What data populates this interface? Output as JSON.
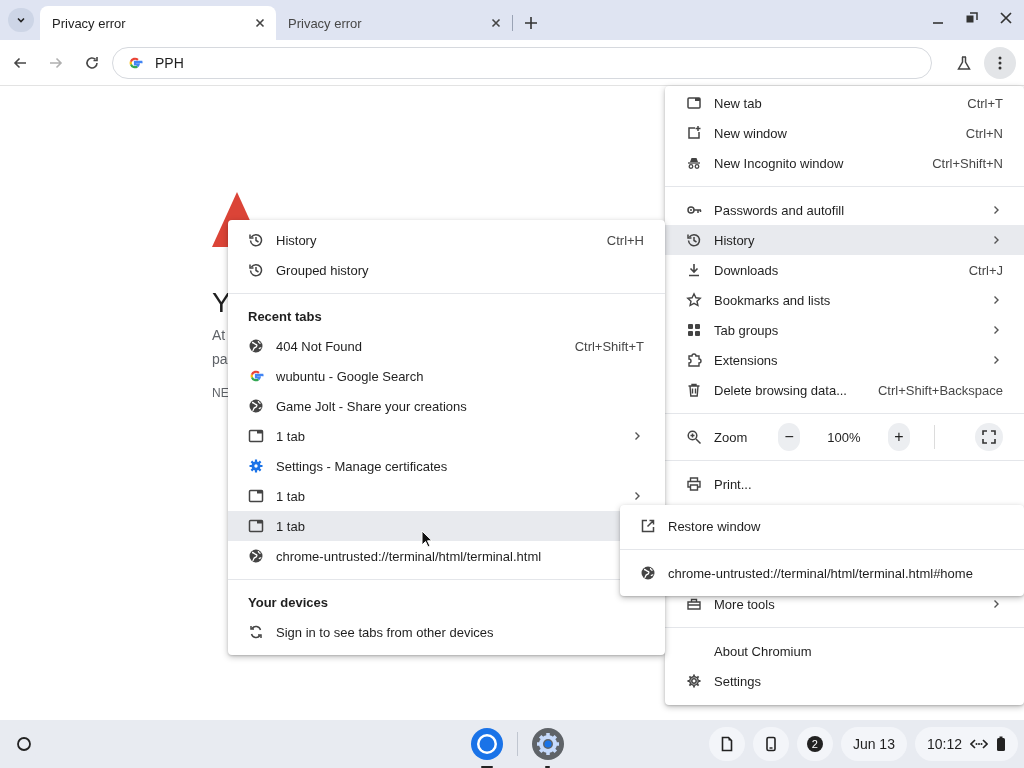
{
  "tabs": [
    {
      "title": "Privacy error",
      "selected": true
    },
    {
      "title": "Privacy error",
      "selected": false
    }
  ],
  "nav": [
    {
      "kind": "back",
      "disabled": false
    },
    {
      "kind": "forward",
      "disabled": true
    },
    {
      "kind": "reload",
      "disabled": false
    }
  ],
  "address": {
    "value": "PPH"
  },
  "page": {
    "heading": "Y",
    "lines": [
      "At",
      "pa"
    ],
    "code": "NE"
  },
  "main_menu": {
    "sections": [
      {
        "items": [
          {
            "kind": "new-tab",
            "label": "New tab",
            "shortcut": "Ctrl+T",
            "selected": false
          },
          {
            "kind": "new-window",
            "label": "New window",
            "shortcut": "Ctrl+N",
            "selected": false
          },
          {
            "kind": "incognito",
            "label": "New Incognito window",
            "shortcut": "Ctrl+Shift+N",
            "selected": false
          }
        ]
      },
      {
        "items": [
          {
            "kind": "key",
            "label": "Passwords and autofill",
            "submenu": true,
            "selected": false
          },
          {
            "kind": "history",
            "label": "History",
            "submenu": true,
            "selected": true
          },
          {
            "kind": "download",
            "label": "Downloads",
            "shortcut": "Ctrl+J",
            "selected": false
          },
          {
            "kind": "star",
            "label": "Bookmarks and lists",
            "submenu": true,
            "selected": false
          },
          {
            "kind": "grid",
            "label": "Tab groups",
            "submenu": true,
            "selected": false
          },
          {
            "kind": "puzzle",
            "label": "Extensions",
            "submenu": true,
            "selected": false
          },
          {
            "kind": "trash",
            "label": "Delete browsing data...",
            "shortcut": "Ctrl+Shift+Backspace",
            "selected": false
          }
        ]
      },
      {
        "items": [
          {
            "kind": "zoom",
            "label": "Zoom",
            "minus": "−",
            "value": "100%",
            "plus": "+",
            "selected": false
          }
        ]
      },
      {
        "items": [
          {
            "kind": "printer",
            "label": "Print...",
            "selected": false
          },
          {
            "kind": "toolbox",
            "label": "More tools",
            "submenu": true,
            "selected": false
          }
        ]
      },
      {
        "items": [
          {
            "kind": "plain",
            "label": "About Chromium",
            "selected": false
          },
          {
            "kind": "gear",
            "label": "Settings",
            "selected": false
          }
        ]
      }
    ]
  },
  "history_menu": {
    "sections": [
      {
        "items": [
          {
            "kind": "history",
            "label": "History",
            "shortcut": "Ctrl+H",
            "selected": false
          },
          {
            "kind": "history",
            "label": "Grouped history",
            "selected": false
          }
        ]
      },
      {
        "heading": "Recent tabs",
        "items": [
          {
            "kind": "globe",
            "label": "404 Not Found",
            "shortcut": "Ctrl+Shift+T",
            "selected": false
          },
          {
            "kind": "google",
            "label": "wubuntu - Google Search",
            "selected": false
          },
          {
            "kind": "globe",
            "label": "Game Jolt - Share your creations",
            "selected": false
          },
          {
            "kind": "window",
            "label": "1 tab",
            "submenu": true,
            "selected": false
          },
          {
            "kind": "gear-blue",
            "label": "Settings - Manage certificates",
            "selected": false
          },
          {
            "kind": "window",
            "label": "1 tab",
            "submenu": true,
            "selected": false
          },
          {
            "kind": "window",
            "label": "1 tab",
            "submenu": false,
            "selected": true
          },
          {
            "kind": "globe",
            "label": "chrome-untrusted://terminal/html/terminal.html",
            "selected": false
          }
        ]
      },
      {
        "heading": "Your devices",
        "items": [
          {
            "kind": "sync",
            "label": "Sign in to see tabs from other devices",
            "selected": false
          }
        ]
      }
    ]
  },
  "tab_submenu": {
    "sections": [
      {
        "items": [
          {
            "kind": "external",
            "label": "Restore window",
            "selected": false
          }
        ]
      },
      {
        "items": [
          {
            "kind": "globe",
            "label": "chrome-untrusted://terminal/html/terminal.html#home",
            "selected": false
          }
        ]
      }
    ]
  },
  "shelf": {
    "apps": [
      {
        "kind": "chromium"
      },
      {
        "kind": "settings"
      }
    ],
    "notification_count": "2",
    "date": "Jun 13",
    "time": "10:12"
  }
}
